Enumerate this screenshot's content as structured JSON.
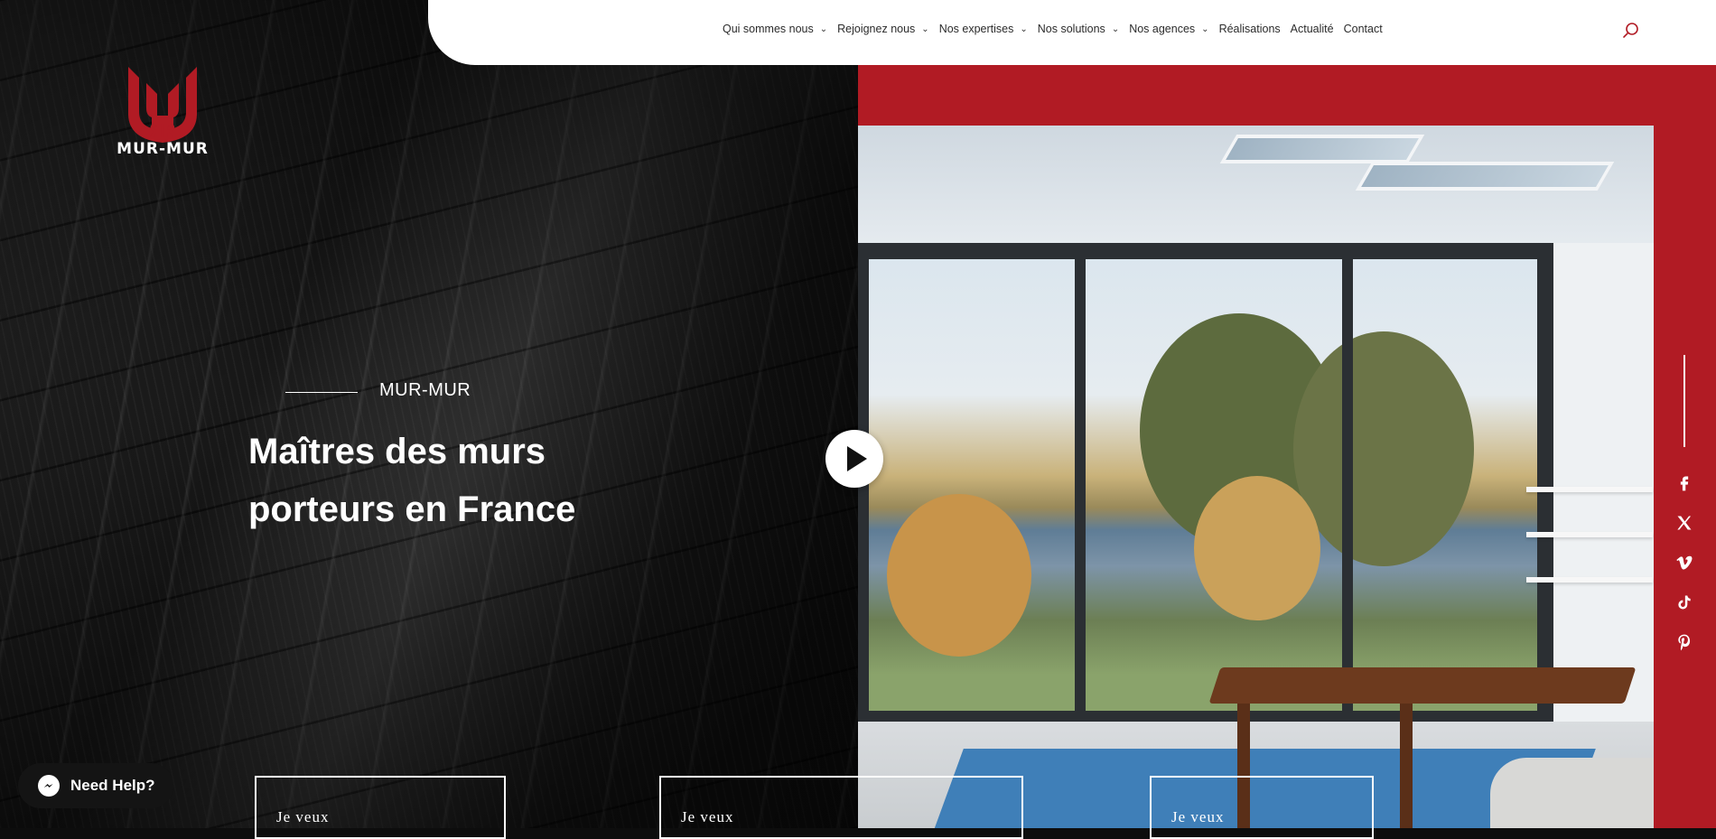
{
  "nav": {
    "items": [
      {
        "label": "Qui sommes nous",
        "dropdown": true
      },
      {
        "label": "Rejoignez nous",
        "dropdown": true
      },
      {
        "label": "Nos expertises",
        "dropdown": true
      },
      {
        "label": "Nos solutions",
        "dropdown": true
      },
      {
        "label": "Nos agences",
        "dropdown": true
      },
      {
        "label": "Réalisations",
        "dropdown": false
      },
      {
        "label": "Actualité",
        "dropdown": false
      },
      {
        "label": "Contact",
        "dropdown": false
      }
    ],
    "search_icon": "search-icon",
    "chevron_icon": "chevron-down-icon"
  },
  "logo": {
    "text": "MUR-MUR"
  },
  "hero": {
    "eyebrow": "MUR-MUR",
    "title_line1": "Maîtres des murs",
    "title_line2": "porteurs en France"
  },
  "video": {
    "icon": "play-icon"
  },
  "social": [
    "facebook-icon",
    "x-icon",
    "vimeo-icon",
    "tiktok-icon",
    "pinterest-icon"
  ],
  "cta": [
    {
      "label": "Je  veux"
    },
    {
      "label": "Je  veux"
    },
    {
      "label": "Je  veux"
    }
  ],
  "help": {
    "label": "Need Help?",
    "icon": "messenger-icon"
  },
  "colors": {
    "brand_red": "#b11b24",
    "nav_text": "#2b2b2b",
    "search_accent": "#b11b24"
  }
}
